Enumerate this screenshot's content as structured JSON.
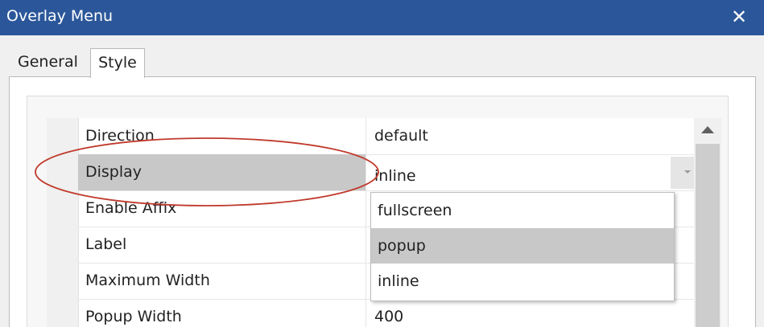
{
  "window": {
    "title": "Overlay Menu",
    "close_glyph": "✕",
    "close_icon": "close-icon",
    "title_bar_color": "#2b579a"
  },
  "tabs": [
    {
      "label": "General",
      "active": false
    },
    {
      "label": "Style",
      "active": true
    }
  ],
  "properties": [
    {
      "name": "Direction",
      "value": "default"
    },
    {
      "name": "Display",
      "value": "inline"
    },
    {
      "name": "Enable Affix",
      "value": ""
    },
    {
      "name": "Label",
      "value": ""
    },
    {
      "name": "Maximum Width",
      "value": ""
    },
    {
      "name": "Popup Width",
      "value": "400"
    }
  ],
  "dropdown": {
    "options": [
      "fullscreen",
      "popup",
      "inline"
    ],
    "highlighted": "popup",
    "caret_icon": "chevron-down-icon"
  },
  "scrollbar": {
    "up_icon": "scroll-up-arrow-icon"
  },
  "annotation": {
    "shape": "ellipse",
    "color": "#c0392b"
  }
}
